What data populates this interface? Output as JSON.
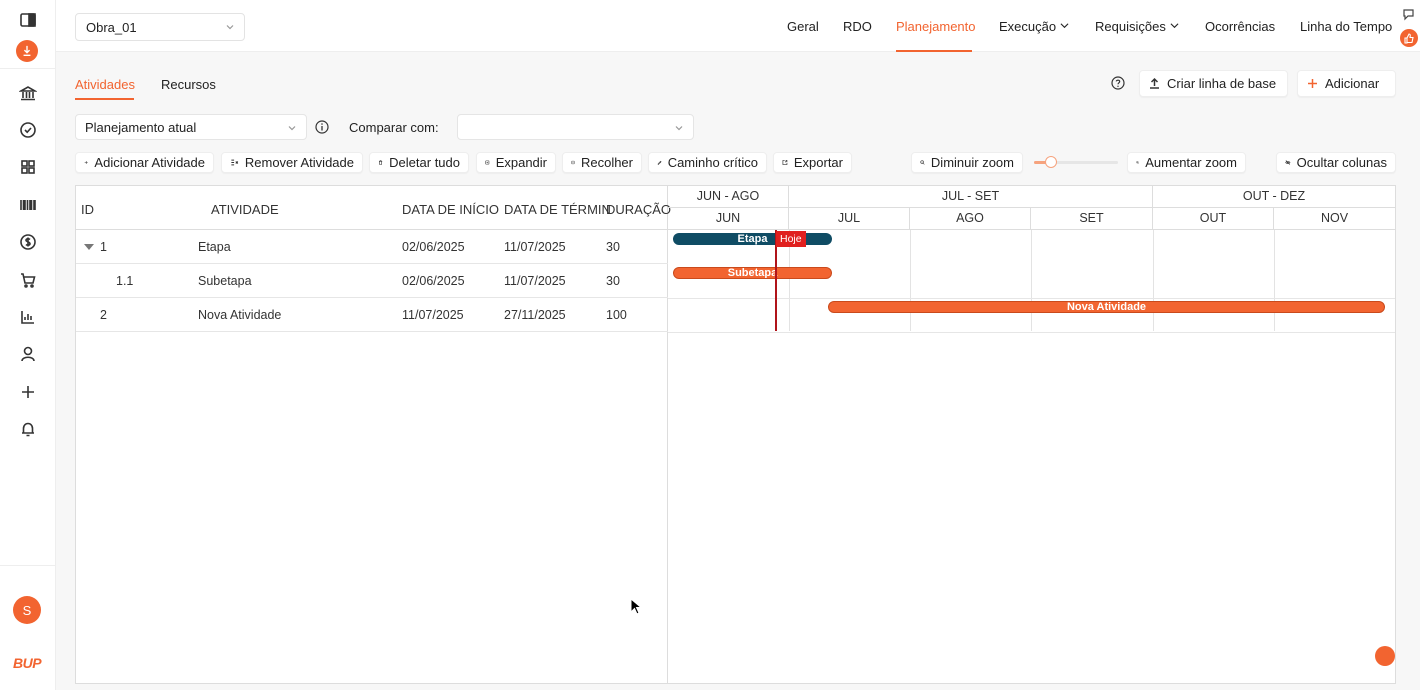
{
  "project": {
    "selected": "Obra_01"
  },
  "nav": {
    "items": [
      {
        "label": "Geral"
      },
      {
        "label": "RDO"
      },
      {
        "label": "Planejamento"
      },
      {
        "label": "Execução"
      },
      {
        "label": "Requisições"
      },
      {
        "label": "Ocorrências"
      },
      {
        "label": "Linha do Tempo"
      }
    ],
    "active": "Planejamento"
  },
  "subtabs": {
    "atividades": "Atividades",
    "recursos": "Recursos",
    "active": "Atividades"
  },
  "actions": {
    "baseline": "Criar linha de base",
    "add": "Adicionar"
  },
  "plan": {
    "selected": "Planejamento atual",
    "compare_label": "Comparar com:",
    "compare_value": ""
  },
  "toolbar": {
    "add_activity": "Adicionar Atividade",
    "remove_activity": "Remover Atividade",
    "delete_all": "Deletar tudo",
    "expand": "Expandir",
    "collapse": "Recolher",
    "critical_path": "Caminho crítico",
    "export": "Exportar",
    "zoom_out": "Diminuir zoom",
    "zoom_in": "Aumentar zoom",
    "zoom_level": 0.2,
    "hide_columns": "Ocultar colunas"
  },
  "table": {
    "headers": {
      "id": "ID",
      "activity": "ATIVIDADE",
      "start": "DATA DE INÍCIO",
      "end": "DATA DE TÉRMIN",
      "duration": "DURAÇÃO"
    },
    "rows": [
      {
        "id": "1",
        "activity": "Etapa",
        "start": "02/06/2025",
        "end": "11/07/2025",
        "duration": "30"
      },
      {
        "id": "1.1",
        "activity": "Subetapa",
        "start": "02/06/2025",
        "end": "11/07/2025",
        "duration": "30"
      },
      {
        "id": "2",
        "activity": "Nova Atividade",
        "start": "11/07/2025",
        "end": "27/11/2025",
        "duration": "100"
      }
    ]
  },
  "gantt": {
    "quarters": [
      "JUN - AGO",
      "JUL - SET",
      "OUT - DEZ"
    ],
    "months": [
      "JUN",
      "JUL",
      "AGO",
      "SET",
      "OUT",
      "NOV"
    ],
    "bars": [
      {
        "label": "Etapa",
        "type": "summary"
      },
      {
        "label": "Subetapa",
        "type": "task"
      },
      {
        "label": "Nova Atividade",
        "type": "task"
      }
    ],
    "today_label": "Hoje",
    "colors": {
      "summary": "#0f4c64",
      "task": "#f26430",
      "today": "#e0201f",
      "accent": "#f26430"
    }
  },
  "user": {
    "initial": "S"
  },
  "brand": "BUP"
}
